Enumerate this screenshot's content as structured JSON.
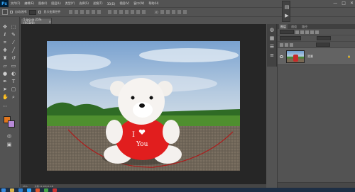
{
  "menubar": {
    "logo": "Ps",
    "items": [
      "文件(F)",
      "编辑(E)",
      "图像(I)",
      "图层(L)",
      "类型(Y)",
      "选择(S)",
      "滤镜(T)",
      "3D(D)",
      "视图(V)",
      "窗口(W)",
      "帮助(H)"
    ],
    "controls": [
      "—",
      "□",
      "✕"
    ]
  },
  "options": {
    "auto_select_label": "自动选择:",
    "show_transform_label": "显示变换控件"
  },
  "document": {
    "tab_title": "5.jpg @ 25%(RGB/8)",
    "close": "×",
    "zoom": "25%",
    "doc_info": "文档:11.1M/11.1M"
  },
  "layers_panel": {
    "tabs": [
      "图层",
      "通道",
      "路径"
    ],
    "layer_name": "背景"
  },
  "colors": {
    "foreground": "#e0761e",
    "background": "#b88ad8",
    "accent": "#31a8ff"
  },
  "toolbar_icons": [
    "move-tool",
    "marquee-tool",
    "lasso-tool",
    "quick-select-tool",
    "crop-tool",
    "eyedropper-tool",
    "healing-brush-tool",
    "brush-tool",
    "clone-stamp-tool",
    "history-brush-tool",
    "eraser-tool",
    "gradient-tool",
    "blur-tool",
    "dodge-tool",
    "pen-tool",
    "type-tool",
    "path-select-tool",
    "shape-tool",
    "hand-tool",
    "zoom-tool"
  ]
}
